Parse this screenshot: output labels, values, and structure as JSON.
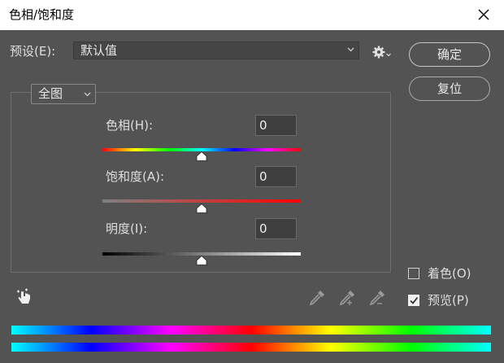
{
  "window": {
    "title": "色相/饱和度",
    "close_icon": "close-icon"
  },
  "preset": {
    "label": "预设(E):",
    "value": "默认值"
  },
  "buttons": {
    "ok": "确定",
    "reset": "复位"
  },
  "channel": {
    "value": "全图"
  },
  "sliders": {
    "hue": {
      "label": "色相(H):",
      "value": "0"
    },
    "saturation": {
      "label": "饱和度(A):",
      "value": "0"
    },
    "lightness": {
      "label": "明度(I):",
      "value": "0"
    }
  },
  "options": {
    "colorize": {
      "label": "着色(O)",
      "checked": false
    },
    "preview": {
      "label": "预览(P)",
      "checked": true
    }
  },
  "colors": {
    "background": "#535353",
    "titlebar": "#ffffff"
  }
}
